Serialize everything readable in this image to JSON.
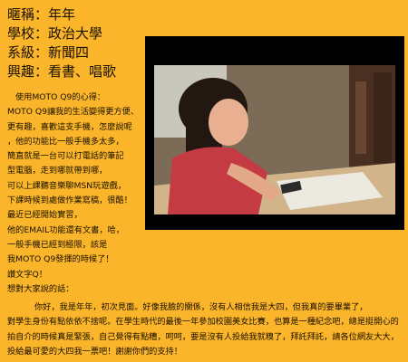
{
  "profile": {
    "nickname": "暱稱：年年",
    "school": "學校：政治大學",
    "department": "系級：新聞四",
    "hobbies": "興趣：看書、唱歌"
  },
  "photo": {
    "icon": "girl-using-phone-photo"
  },
  "story": {
    "heading": "使用MOTO Q9的心得：",
    "lines": [
      "MOTO Q9讓我的生活變得更方便、",
      "更有趣，喜歡這支手機，怎麼說呢",
      "，他的功能比一般手機多太多，",
      "簡直就是一台可以打電話的筆記",
      "型電腦，走到哪就帶到哪，",
      "可以上課聽音樂聊MSN玩遊戲，",
      "下課時候到處做作業寫稿，很酷！",
      "最近已經開始實習，",
      "他的EMAIL功能還有文書，哈，",
      "一般手機已經到極限，該是",
      "我MOTO Q9發揮的時候了！",
      "讚文字Q！",
      "想對大家說的話："
    ]
  },
  "message": {
    "lines": [
      "你好，我是年年，初次見面。好像我臉的關係，沒有人相信我是大四，但我真的要畢業了，",
      "對學生身份有點依依不捨呢。在學生時代的最後一年參加校園美女比賽，也算是一種紀念吧，總是挺開心的",
      "拍自介的時候真是緊張，自己覺得有點糟，呵呵，要是沒有人投給我就糗了，拜託拜託，請各位網友大大，",
      "投給最可愛的大四我一票吧！謝謝你們的支持！"
    ]
  }
}
